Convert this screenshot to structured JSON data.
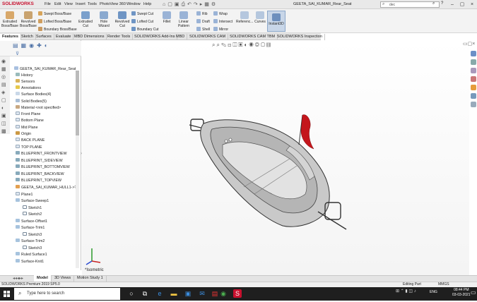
{
  "app": {
    "logo_text": "SOLIDWORKS",
    "doc_title": "GEETA_SAI_KUMAR_Rear_Seat",
    "search_value": "dec"
  },
  "menu": [
    "File",
    "Edit",
    "View",
    "Insert",
    "Tools",
    "PhotoView 360",
    "Window",
    "Help"
  ],
  "ribbon": {
    "extruded_boss": "Extruded Boss/Base",
    "revolved_boss": "Revolved Boss/Base",
    "swept_boss": "Swept Boss/Base",
    "lofted_boss": "Lofted Boss/Base",
    "boundary_boss": "Boundary Boss/Base",
    "extruded_cut": "Extruded Cut",
    "hole_wizard": "Hole Wizard",
    "revolved_cut": "Revolved Cut",
    "swept_cut": "Swept Cut",
    "lofted_cut": "Lofted Cut",
    "boundary_cut": "Boundary Cut",
    "fillet": "Fillet",
    "linear_pattern": "Linear Pattern",
    "rib": "Rib",
    "wrap": "Wrap",
    "draft": "Draft",
    "intersect": "Intersect",
    "shell": "Shell",
    "mirror": "Mirror",
    "reference": "Referenc...",
    "curves": "Curves",
    "instant3d": "Instant3D"
  },
  "tabs": [
    "Features",
    "Sketch",
    "Surfaces",
    "Evaluate",
    "MBD Dimensions",
    "Render Tools",
    "SOLIDWORKS Add-Ins",
    "MBD",
    "SOLIDWORKS CAM",
    "SOLIDWORKS CAM TBM",
    "SOLIDWORKS Inspection"
  ],
  "tree": {
    "root": "GEETA_SAI_KUMAR_Rear_Seat",
    "items": [
      "History",
      "Sensors",
      "Annotations",
      "Surface Bodies(4)",
      "Solid Bodies(5)",
      "Material <not specified>",
      "Front Plane",
      "Bottom Plane",
      "Mid Plane",
      "Origin",
      "BACK PLANE",
      "TOP PLANE",
      "BLUEPRINT_FRONTVIEW",
      "BLUEPRINT_SIDEVIEW",
      "BLUEPRINT_BOTTOMVIEW",
      "BLUEPRINT_BACKVIEW",
      "BLUEPRINT_TOPVIEW",
      "GEETA_SAI_KUMAR_HULL1->?",
      "Plane1",
      "Surface-Sweep1",
      "Sketch1",
      "Sketch2",
      "Surface-Offset1",
      "Surface-Trim1",
      "Sketch3",
      "Surface-Trim2",
      "Sketch3",
      "Ruled Surface1",
      "Surface-Knit1"
    ]
  },
  "viewport": {
    "view_label": "*Isometric"
  },
  "bottom_tabs": [
    "Model",
    "3D Views",
    "Motion Study 1"
  ],
  "status": {
    "left": "SOLIDWORKS Premium 2019 SP5.0",
    "mode": "Editing Part",
    "units": "MMGS"
  },
  "taskbar": {
    "search_placeholder": "Type here to search",
    "time": "08:44 PM",
    "date": "03-03-2021",
    "lang": "ENG"
  },
  "colors": {
    "accent": "#c8102e",
    "flag": "#c4161c",
    "taskbar": "#1f1f1f"
  }
}
